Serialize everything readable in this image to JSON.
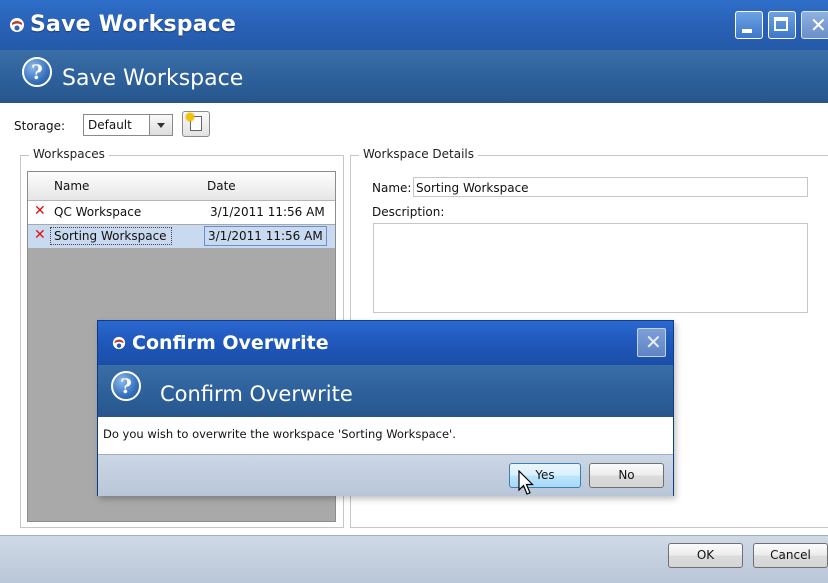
{
  "window": {
    "title": "Save Workspace",
    "header_title": "Save Workspace"
  },
  "toolbar": {
    "storage_label": "Storage:",
    "storage_value": "Default"
  },
  "workspaces": {
    "group_label": "Workspaces",
    "columns": [
      "Name",
      "Date"
    ],
    "rows": [
      {
        "name": "QC Workspace",
        "date": "3/1/2011 11:56 AM"
      },
      {
        "name": "Sorting Workspace",
        "date": "3/1/2011 11:56 AM"
      }
    ]
  },
  "details": {
    "group_label": "Workspace Details",
    "name_label": "Name:",
    "name_value": "Sorting Workspace",
    "description_label": "Description:"
  },
  "footer": {
    "ok_label": "OK",
    "cancel_label": "Cancel"
  },
  "dialog": {
    "title": "Confirm Overwrite",
    "header_title": "Confirm Overwrite",
    "message": "Do you wish to overwrite the workspace 'Sorting Workspace'.",
    "yes_label": "Yes",
    "no_label": "No"
  },
  "colors": {
    "titlebar": "#2a62b8",
    "header": "#2c5f99",
    "delete_x": "#dd1111",
    "selection": "#c9d9ef"
  }
}
